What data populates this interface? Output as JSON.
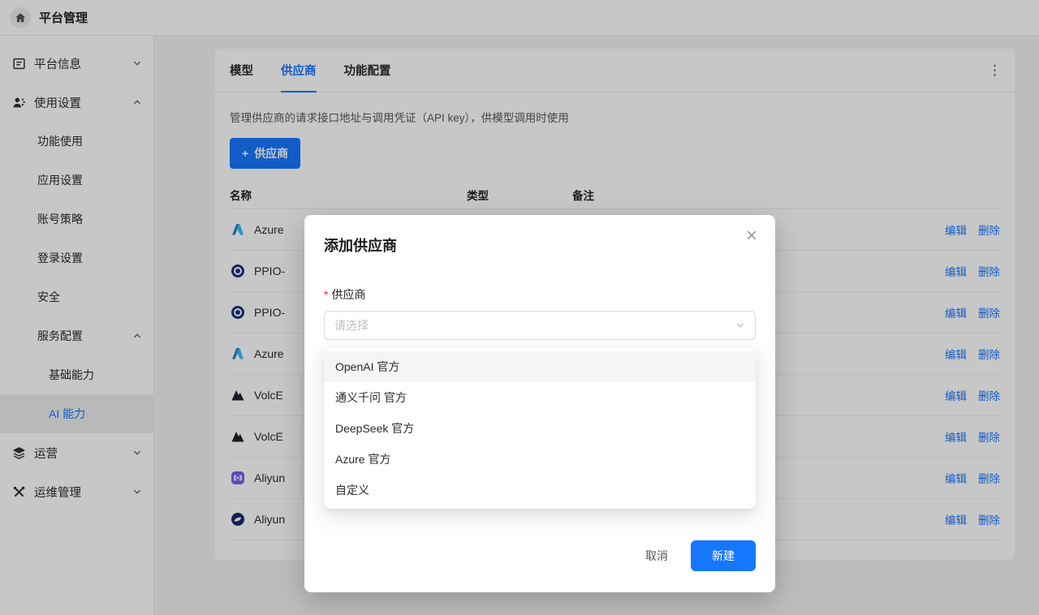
{
  "header": {
    "title": "平台管理"
  },
  "icons": {
    "plus": "+",
    "more": "⋮",
    "close": "×"
  },
  "colors": {
    "accent": "#1677ff",
    "danger": "#f5222d"
  },
  "sidebar": {
    "items": [
      {
        "label": "平台信息",
        "level": 1,
        "chevron": "down"
      },
      {
        "label": "使用设置",
        "level": 1,
        "chevron": "up"
      },
      {
        "label": "功能使用",
        "level": 2
      },
      {
        "label": "应用设置",
        "level": 2
      },
      {
        "label": "账号策略",
        "level": 2
      },
      {
        "label": "登录设置",
        "level": 2
      },
      {
        "label": "安全",
        "level": 2
      },
      {
        "label": "服务配置",
        "level": 2,
        "chevron": "up"
      },
      {
        "label": "基础能力",
        "level": 3
      },
      {
        "label": "AI 能力",
        "level": 3,
        "active": true
      },
      {
        "label": "运营",
        "level": 1,
        "chevron": "down"
      },
      {
        "label": "运维管理",
        "level": 1,
        "chevron": "down"
      }
    ]
  },
  "main": {
    "tabs": [
      {
        "label": "模型",
        "active": false
      },
      {
        "label": "供应商",
        "active": true
      },
      {
        "label": "功能配置",
        "active": false
      }
    ],
    "description": "管理供应商的请求接口地址与调用凭证（API key），供模型调用时使用",
    "add_button_label": "供应商",
    "table": {
      "columns": [
        "名称",
        "类型",
        "备注"
      ],
      "edit_label": "编辑",
      "delete_label": "删除",
      "rows": [
        {
          "name": "Azure",
          "icon": "azure"
        },
        {
          "name": "PPIO-",
          "icon": "ppio"
        },
        {
          "name": "PPIO-",
          "icon": "ppio"
        },
        {
          "name": "Azure",
          "icon": "azure"
        },
        {
          "name": "VolcE",
          "icon": "volcengine"
        },
        {
          "name": "VolcE",
          "icon": "volcengine"
        },
        {
          "name": "Aliyun",
          "icon": "aliyun"
        },
        {
          "name": "Aliyun",
          "icon": "aliyun"
        }
      ]
    }
  },
  "modal": {
    "title": "添加供应商",
    "field": {
      "required_mark": "*",
      "label": "供应商",
      "placeholder": "请选择"
    },
    "dropdown": {
      "highlighted_index": 0,
      "options": [
        "OpenAI 官方",
        "通义千问 官方",
        "DeepSeek 官方",
        "Azure 官方",
        "自定义"
      ]
    },
    "footer": {
      "cancel_label": "取消",
      "create_label": "新建"
    }
  }
}
